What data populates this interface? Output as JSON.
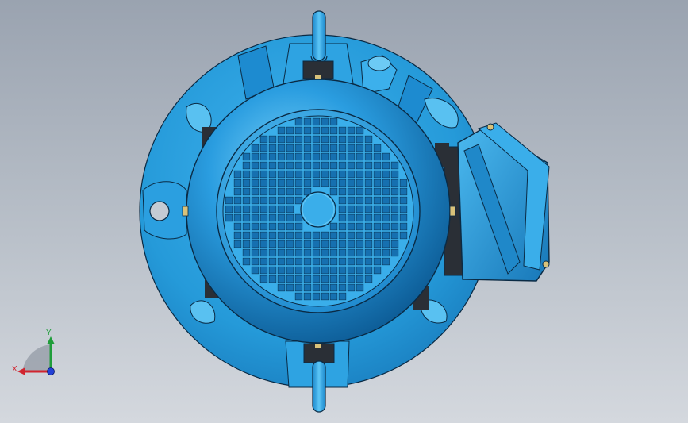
{
  "viewport": {
    "model": "electric-motor",
    "view": "rear"
  },
  "colors": {
    "model_base": "#2b9fe0",
    "model_dark": "#0d5f9a",
    "model_light": "#6ccaf5",
    "outline": "#0a2a44",
    "hardware": "#2a2f36",
    "brass": "#d9c27a",
    "hole": "#c4cbd4",
    "axis_x": "#d1242f",
    "axis_y": "#1f9d3a",
    "axis_z": "#2340d6"
  },
  "triad": {
    "x_label": "X",
    "y_label": "Y"
  }
}
